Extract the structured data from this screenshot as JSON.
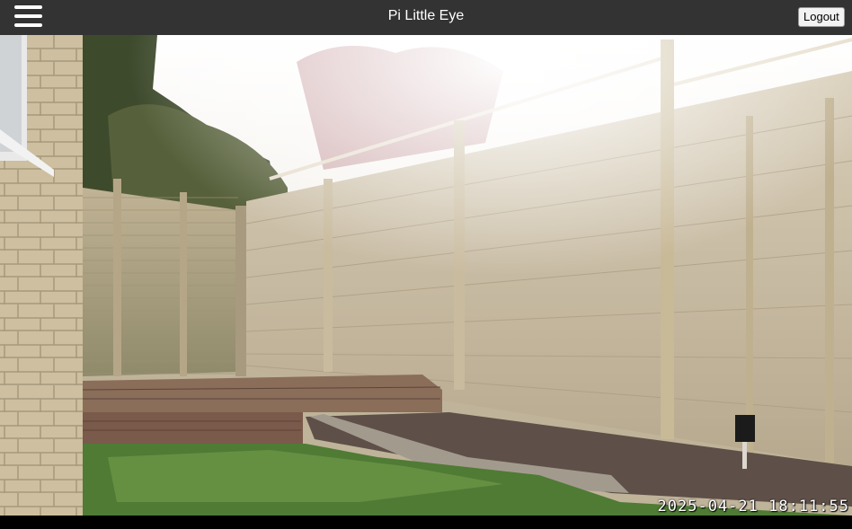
{
  "header": {
    "title": "Pi Little Eye",
    "logout_label": "Logout",
    "menu_icon": "hamburger-menu-icon",
    "background": "#333333"
  },
  "camera": {
    "timestamp": "2025-04-21 18:11:55"
  }
}
